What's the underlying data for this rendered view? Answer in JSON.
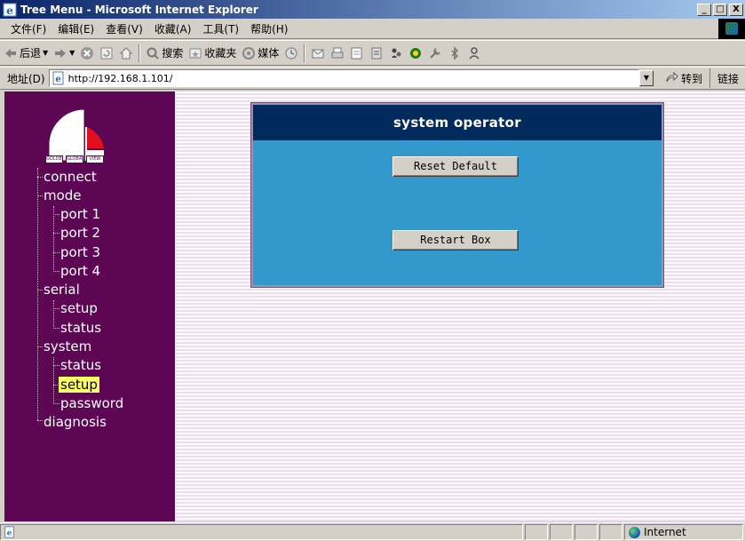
{
  "window": {
    "title": "Tree Menu - Microsoft Internet Explorer",
    "controls": [
      "_",
      "□",
      "X"
    ]
  },
  "menubar": {
    "items": [
      "文件(F)",
      "编辑(E)",
      "查看(V)",
      "收藏(A)",
      "工具(T)",
      "帮助(H)"
    ]
  },
  "toolbar": {
    "back_label": "后退",
    "search_label": "搜索",
    "favorites_label": "收藏夹",
    "media_label": "媒体"
  },
  "addressbar": {
    "label": "地址(D)",
    "url": "http://192.168.1.101/",
    "go_label": "转到",
    "links_label": "链接"
  },
  "logo": {
    "caption": [
      "GOLDEN",
      "GLOBAL",
      "VIEW"
    ]
  },
  "tree": {
    "items": [
      {
        "label": "connect",
        "level": 0,
        "selected": false
      },
      {
        "label": "mode",
        "level": 0,
        "selected": false
      },
      {
        "label": "port 1",
        "level": 1,
        "selected": false
      },
      {
        "label": "port 2",
        "level": 1,
        "selected": false
      },
      {
        "label": "port 3",
        "level": 1,
        "selected": false
      },
      {
        "label": "port 4",
        "level": 1,
        "selected": false
      },
      {
        "label": "serial",
        "level": 0,
        "selected": false
      },
      {
        "label": "setup",
        "level": 1,
        "selected": false
      },
      {
        "label": "status",
        "level": 1,
        "selected": false
      },
      {
        "label": "system",
        "level": 0,
        "selected": false
      },
      {
        "label": "status",
        "level": 1,
        "selected": false
      },
      {
        "label": "setup",
        "level": 1,
        "selected": true
      },
      {
        "label": "password",
        "level": 1,
        "selected": false
      },
      {
        "label": "diagnosis",
        "level": 0,
        "selected": false
      }
    ]
  },
  "panel": {
    "title": "system operator",
    "reset_label": "Reset Default",
    "restart_label": "Restart Box"
  },
  "statusbar": {
    "zone": "Internet"
  },
  "colors": {
    "sidebar": "#5c0654",
    "panel_body": "#3399cc",
    "panel_header": "#002a5c",
    "selection": "#ffff66"
  }
}
